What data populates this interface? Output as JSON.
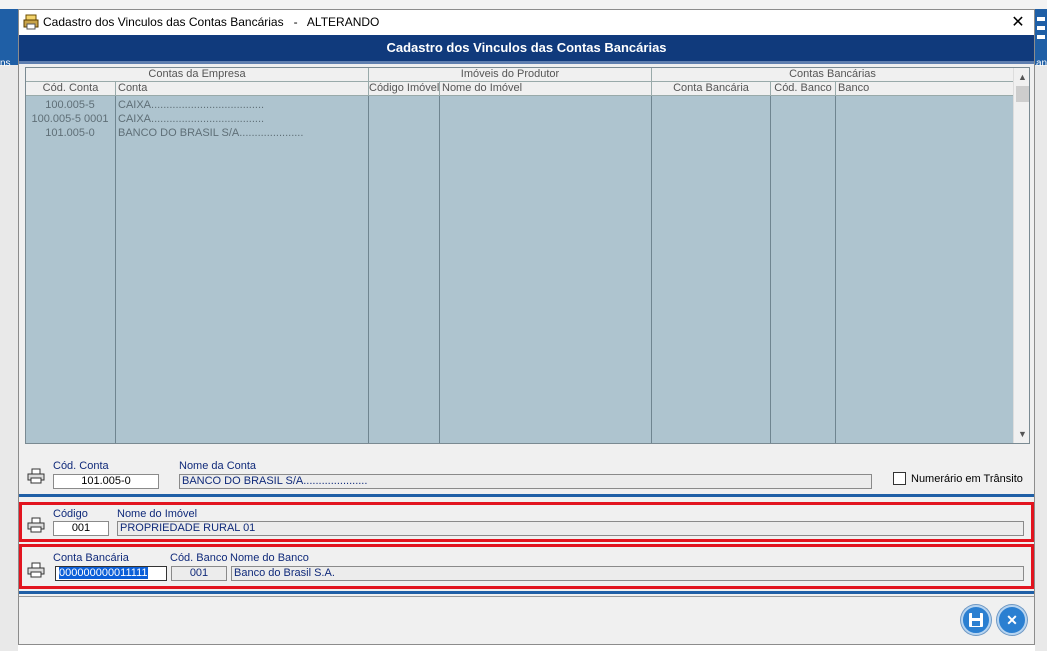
{
  "window": {
    "title": "Cadastro dos Vinculos das Contas Bancárias   -   ALTERANDO",
    "header": "Cadastro dos Vinculos das Contas Bancárias"
  },
  "desktop": {
    "left_text": "ns",
    "right_text": "an"
  },
  "grid": {
    "groups": [
      "Contas da Empresa",
      "Imóveis do Produtor",
      "Contas Bancárias"
    ],
    "columns": [
      "Cód. Conta",
      "Conta",
      "Código Imóvel",
      "Nome do Imóvel",
      "Conta Bancária",
      "Cód. Banco",
      "Banco"
    ],
    "rows": [
      {
        "cod": "100.005-5",
        "conta": "CAIXA....................................."
      },
      {
        "cod": "100.005-5 0001",
        "conta": "CAIXA....................................."
      },
      {
        "cod": "101.005-0",
        "conta": "BANCO DO BRASIL S/A....................."
      }
    ]
  },
  "form_conta": {
    "cod_label": "Cód. Conta",
    "cod_value": "101.005-0",
    "nome_label": "Nome da Conta",
    "nome_value": "BANCO DO BRASIL S/A.....................",
    "numerario_label": "Numerário em Trânsito"
  },
  "form_imovel": {
    "codigo_label": "Código",
    "codigo_value": "001",
    "nome_label": "Nome do Imóvel",
    "nome_value": "PROPRIEDADE RURAL 01"
  },
  "form_banco": {
    "conta_label": "Conta Bancária",
    "conta_value": "000000000011111",
    "cod_banco_label": "Cód. Banco",
    "cod_banco_value": "001",
    "nome_banco_label": "Nome do Banco",
    "nome_banco_value": "Banco do Brasil S.A."
  },
  "buttons": {
    "save_icon": "floppy-disk-icon",
    "cancel_icon": "x-icon"
  },
  "colors": {
    "header_bg": "#103a7c",
    "grid_bg": "#aec4cf",
    "highlight_border": "#e2141f",
    "label_text": "#102a7a"
  }
}
